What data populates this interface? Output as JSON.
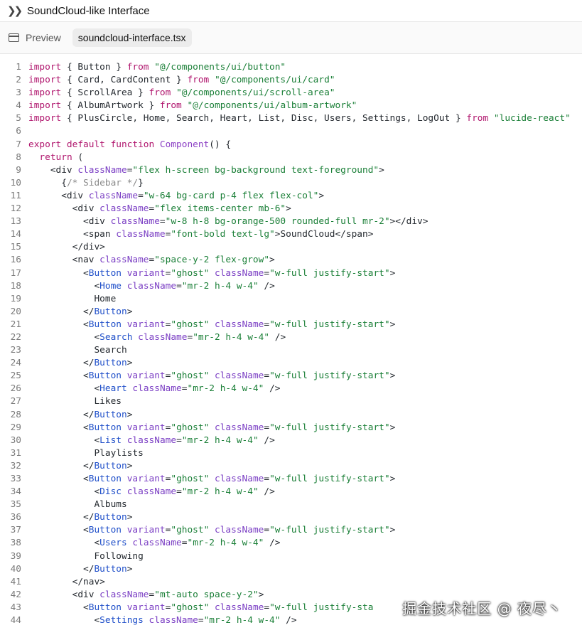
{
  "window": {
    "title": "SoundCloud-like Interface"
  },
  "tabs": {
    "preview_label": "Preview",
    "file_label": "soundcloud-interface.tsx"
  },
  "watermark": "掘金技术社区 @ 夜尽丶",
  "code_lines": [
    [
      [
        "kw",
        "import"
      ],
      [
        "txt",
        " { Button } "
      ],
      [
        "kw",
        "from"
      ],
      [
        "txt",
        " "
      ],
      [
        "str",
        "\"@/components/ui/button\""
      ]
    ],
    [
      [
        "kw",
        "import"
      ],
      [
        "txt",
        " { Card, CardContent } "
      ],
      [
        "kw",
        "from"
      ],
      [
        "txt",
        " "
      ],
      [
        "str",
        "\"@/components/ui/card\""
      ]
    ],
    [
      [
        "kw",
        "import"
      ],
      [
        "txt",
        " { ScrollArea } "
      ],
      [
        "kw",
        "from"
      ],
      [
        "txt",
        " "
      ],
      [
        "str",
        "\"@/components/ui/scroll-area\""
      ]
    ],
    [
      [
        "kw",
        "import"
      ],
      [
        "txt",
        " { AlbumArtwork } "
      ],
      [
        "kw",
        "from"
      ],
      [
        "txt",
        " "
      ],
      [
        "str",
        "\"@/components/ui/album-artwork\""
      ]
    ],
    [
      [
        "kw",
        "import"
      ],
      [
        "txt",
        " { PlusCircle, Home, Search, Heart, List, Disc, Users, Settings, LogOut } "
      ],
      [
        "kw",
        "from"
      ],
      [
        "txt",
        " "
      ],
      [
        "str",
        "\"lucide-react\""
      ]
    ],
    [],
    [
      [
        "kw",
        "export default function"
      ],
      [
        "txt",
        " "
      ],
      [
        "fn",
        "Component"
      ],
      [
        "txt",
        "() {"
      ]
    ],
    [
      [
        "txt",
        "  "
      ],
      [
        "kw",
        "return"
      ],
      [
        "txt",
        " ("
      ]
    ],
    [
      [
        "txt",
        "    <div "
      ],
      [
        "attr",
        "className"
      ],
      [
        "txt",
        "="
      ],
      [
        "str",
        "\"flex h-screen bg-background text-foreground\""
      ],
      [
        "txt",
        ">"
      ]
    ],
    [
      [
        "txt",
        "      {"
      ],
      [
        "cm",
        "/* Sidebar */"
      ],
      [
        "txt",
        "}"
      ]
    ],
    [
      [
        "txt",
        "      <div "
      ],
      [
        "attr",
        "className"
      ],
      [
        "txt",
        "="
      ],
      [
        "str",
        "\"w-64 bg-card p-4 flex flex-col\""
      ],
      [
        "txt",
        ">"
      ]
    ],
    [
      [
        "txt",
        "        <div "
      ],
      [
        "attr",
        "className"
      ],
      [
        "txt",
        "="
      ],
      [
        "str",
        "\"flex items-center mb-6\""
      ],
      [
        "txt",
        ">"
      ]
    ],
    [
      [
        "txt",
        "          <div "
      ],
      [
        "attr",
        "className"
      ],
      [
        "txt",
        "="
      ],
      [
        "str",
        "\"w-8 h-8 bg-orange-500 rounded-full mr-2\""
      ],
      [
        "txt",
        "></div>"
      ]
    ],
    [
      [
        "txt",
        "          <span "
      ],
      [
        "attr",
        "className"
      ],
      [
        "txt",
        "="
      ],
      [
        "str",
        "\"font-bold text-lg\""
      ],
      [
        "txt",
        ">SoundCloud</span>"
      ]
    ],
    [
      [
        "txt",
        "        </div>"
      ]
    ],
    [
      [
        "txt",
        "        <nav "
      ],
      [
        "attr",
        "className"
      ],
      [
        "txt",
        "="
      ],
      [
        "str",
        "\"space-y-2 flex-grow\""
      ],
      [
        "txt",
        ">"
      ]
    ],
    [
      [
        "txt",
        "          <"
      ],
      [
        "tag",
        "Button"
      ],
      [
        "txt",
        " "
      ],
      [
        "attr",
        "variant"
      ],
      [
        "txt",
        "="
      ],
      [
        "str",
        "\"ghost\""
      ],
      [
        "txt",
        " "
      ],
      [
        "attr",
        "className"
      ],
      [
        "txt",
        "="
      ],
      [
        "str",
        "\"w-full justify-start\""
      ],
      [
        "txt",
        ">"
      ]
    ],
    [
      [
        "txt",
        "            <"
      ],
      [
        "tag",
        "Home"
      ],
      [
        "txt",
        " "
      ],
      [
        "attr",
        "className"
      ],
      [
        "txt",
        "="
      ],
      [
        "str",
        "\"mr-2 h-4 w-4\""
      ],
      [
        "txt",
        " />"
      ]
    ],
    [
      [
        "txt",
        "            Home"
      ]
    ],
    [
      [
        "txt",
        "          </"
      ],
      [
        "tag",
        "Button"
      ],
      [
        "txt",
        ">"
      ]
    ],
    [
      [
        "txt",
        "          <"
      ],
      [
        "tag",
        "Button"
      ],
      [
        "txt",
        " "
      ],
      [
        "attr",
        "variant"
      ],
      [
        "txt",
        "="
      ],
      [
        "str",
        "\"ghost\""
      ],
      [
        "txt",
        " "
      ],
      [
        "attr",
        "className"
      ],
      [
        "txt",
        "="
      ],
      [
        "str",
        "\"w-full justify-start\""
      ],
      [
        "txt",
        ">"
      ]
    ],
    [
      [
        "txt",
        "            <"
      ],
      [
        "tag",
        "Search"
      ],
      [
        "txt",
        " "
      ],
      [
        "attr",
        "className"
      ],
      [
        "txt",
        "="
      ],
      [
        "str",
        "\"mr-2 h-4 w-4\""
      ],
      [
        "txt",
        " />"
      ]
    ],
    [
      [
        "txt",
        "            Search"
      ]
    ],
    [
      [
        "txt",
        "          </"
      ],
      [
        "tag",
        "Button"
      ],
      [
        "txt",
        ">"
      ]
    ],
    [
      [
        "txt",
        "          <"
      ],
      [
        "tag",
        "Button"
      ],
      [
        "txt",
        " "
      ],
      [
        "attr",
        "variant"
      ],
      [
        "txt",
        "="
      ],
      [
        "str",
        "\"ghost\""
      ],
      [
        "txt",
        " "
      ],
      [
        "attr",
        "className"
      ],
      [
        "txt",
        "="
      ],
      [
        "str",
        "\"w-full justify-start\""
      ],
      [
        "txt",
        ">"
      ]
    ],
    [
      [
        "txt",
        "            <"
      ],
      [
        "tag",
        "Heart"
      ],
      [
        "txt",
        " "
      ],
      [
        "attr",
        "className"
      ],
      [
        "txt",
        "="
      ],
      [
        "str",
        "\"mr-2 h-4 w-4\""
      ],
      [
        "txt",
        " />"
      ]
    ],
    [
      [
        "txt",
        "            Likes"
      ]
    ],
    [
      [
        "txt",
        "          </"
      ],
      [
        "tag",
        "Button"
      ],
      [
        "txt",
        ">"
      ]
    ],
    [
      [
        "txt",
        "          <"
      ],
      [
        "tag",
        "Button"
      ],
      [
        "txt",
        " "
      ],
      [
        "attr",
        "variant"
      ],
      [
        "txt",
        "="
      ],
      [
        "str",
        "\"ghost\""
      ],
      [
        "txt",
        " "
      ],
      [
        "attr",
        "className"
      ],
      [
        "txt",
        "="
      ],
      [
        "str",
        "\"w-full justify-start\""
      ],
      [
        "txt",
        ">"
      ]
    ],
    [
      [
        "txt",
        "            <"
      ],
      [
        "tag",
        "List"
      ],
      [
        "txt",
        " "
      ],
      [
        "attr",
        "className"
      ],
      [
        "txt",
        "="
      ],
      [
        "str",
        "\"mr-2 h-4 w-4\""
      ],
      [
        "txt",
        " />"
      ]
    ],
    [
      [
        "txt",
        "            Playlists"
      ]
    ],
    [
      [
        "txt",
        "          </"
      ],
      [
        "tag",
        "Button"
      ],
      [
        "txt",
        ">"
      ]
    ],
    [
      [
        "txt",
        "          <"
      ],
      [
        "tag",
        "Button"
      ],
      [
        "txt",
        " "
      ],
      [
        "attr",
        "variant"
      ],
      [
        "txt",
        "="
      ],
      [
        "str",
        "\"ghost\""
      ],
      [
        "txt",
        " "
      ],
      [
        "attr",
        "className"
      ],
      [
        "txt",
        "="
      ],
      [
        "str",
        "\"w-full justify-start\""
      ],
      [
        "txt",
        ">"
      ]
    ],
    [
      [
        "txt",
        "            <"
      ],
      [
        "tag",
        "Disc"
      ],
      [
        "txt",
        " "
      ],
      [
        "attr",
        "className"
      ],
      [
        "txt",
        "="
      ],
      [
        "str",
        "\"mr-2 h-4 w-4\""
      ],
      [
        "txt",
        " />"
      ]
    ],
    [
      [
        "txt",
        "            Albums"
      ]
    ],
    [
      [
        "txt",
        "          </"
      ],
      [
        "tag",
        "Button"
      ],
      [
        "txt",
        ">"
      ]
    ],
    [
      [
        "txt",
        "          <"
      ],
      [
        "tag",
        "Button"
      ],
      [
        "txt",
        " "
      ],
      [
        "attr",
        "variant"
      ],
      [
        "txt",
        "="
      ],
      [
        "str",
        "\"ghost\""
      ],
      [
        "txt",
        " "
      ],
      [
        "attr",
        "className"
      ],
      [
        "txt",
        "="
      ],
      [
        "str",
        "\"w-full justify-start\""
      ],
      [
        "txt",
        ">"
      ]
    ],
    [
      [
        "txt",
        "            <"
      ],
      [
        "tag",
        "Users"
      ],
      [
        "txt",
        " "
      ],
      [
        "attr",
        "className"
      ],
      [
        "txt",
        "="
      ],
      [
        "str",
        "\"mr-2 h-4 w-4\""
      ],
      [
        "txt",
        " />"
      ]
    ],
    [
      [
        "txt",
        "            Following"
      ]
    ],
    [
      [
        "txt",
        "          </"
      ],
      [
        "tag",
        "Button"
      ],
      [
        "txt",
        ">"
      ]
    ],
    [
      [
        "txt",
        "        </nav>"
      ]
    ],
    [
      [
        "txt",
        "        <div "
      ],
      [
        "attr",
        "className"
      ],
      [
        "txt",
        "="
      ],
      [
        "str",
        "\"mt-auto space-y-2\""
      ],
      [
        "txt",
        ">"
      ]
    ],
    [
      [
        "txt",
        "          <"
      ],
      [
        "tag",
        "Button"
      ],
      [
        "txt",
        " "
      ],
      [
        "attr",
        "variant"
      ],
      [
        "txt",
        "="
      ],
      [
        "str",
        "\"ghost\""
      ],
      [
        "txt",
        " "
      ],
      [
        "attr",
        "className"
      ],
      [
        "txt",
        "="
      ],
      [
        "str",
        "\"w-full justify-sta"
      ]
    ],
    [
      [
        "txt",
        "            <"
      ],
      [
        "tag",
        "Settings"
      ],
      [
        "txt",
        " "
      ],
      [
        "attr",
        "className"
      ],
      [
        "txt",
        "="
      ],
      [
        "str",
        "\"mr-2 h-4 w-4\""
      ],
      [
        "txt",
        " />"
      ]
    ]
  ]
}
